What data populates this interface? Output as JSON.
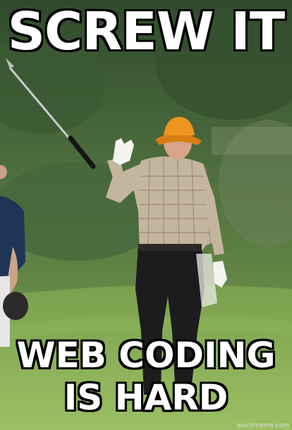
{
  "meme": {
    "top_text": "SCREW IT",
    "bottom_text": "WEB CODING IS HARD",
    "watermark": "quickmeme.com"
  },
  "scene": {
    "description_icons": [
      "golf-club-icon",
      "golfer-figure",
      "bucket-hat-icon",
      "golf-glove-icon"
    ],
    "colors": {
      "sky_trees": "#3c5a36",
      "fairway": "#7ea353",
      "hat": "#f0961e",
      "shirt": "#c9b9a0",
      "trousers": "#1c1c1e",
      "glove": "#f4f4f0"
    }
  }
}
